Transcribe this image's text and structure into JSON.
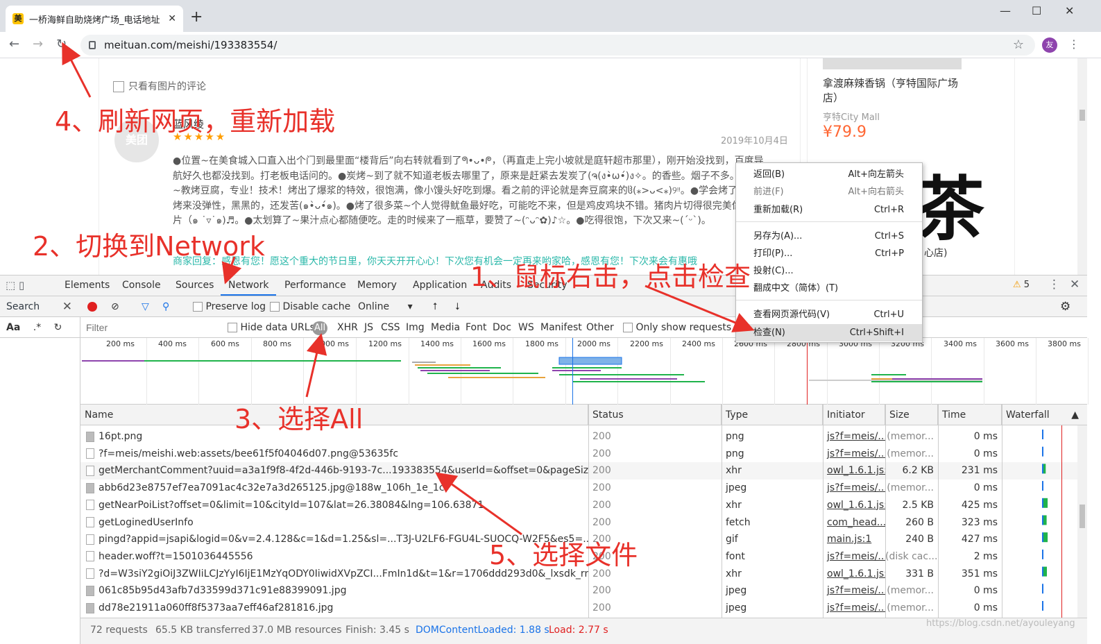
{
  "browser": {
    "tab_title": "一桥海鲜自助烧烤广场_电话地址",
    "tab_favicon": "美",
    "url": "meituan.com/meishi/193383554/",
    "avatar_letter": "友"
  },
  "page": {
    "only_pictures_label": "只看有图片的评论",
    "avatar_text": "美团",
    "reviewer_name": "蓝风绫",
    "stars": "★★★★★",
    "review_date": "2019年10月4日",
    "review_text": "●位置~在美食城入口直入出个门到最里面“楼背后”向右转就看到了ᖗ•ᴗ•ᖘ，（再直走上完小坡就是庭轩超市那里），刚开始没找到，百度导航好久也都没找到。打老板电话问的。●炭烤~到了就不知道老板去哪里了，原来是赶紧去发炭了(ຈ(ง•̀ω•́)ง✧。的香些。烟子不多。●老板~教烤豆腐，专业！技术！烤出了爆浆的特效，很饱满，像小馒头好吃到爆。看之前的评论就是奔豆腐来的ჱ(⁎>ᴗ<⁎)୨ᵎᵎ。●学会烤了~但是烤来没弹性，黑黑的，还发苦(๑•̀ᴗ•́๑)。●烤了很多菜~个人觉得鱿鱼最好吃，可能吃不来，但是鸡皮鸡块不错。猪肉片切得很完美像牛羊肉片（๑ ˙▿˙๑)♬。●太划算了~果汁点心都随便吃。走的时候来了一瓶草，要赞了~(ᵔᴗᵔ✿)♪☆。●吃得很饱，下次又来~(ˊᵕˋ)。",
    "merchant_reply": "商家回复：感恩有您！愿这个重大的节日里，你天天开开心心！下次您有机会一定再来哟家哈，感恩有您！下次来会有惠哦",
    "side_shop_name": "拿渡麻辣香锅（亨特国际广场店）",
    "side_shop_addr": "亨特City Mall",
    "side_shop_price": "¥79.9",
    "side_big_char": "茶",
    "side_big_sub": "心店)"
  },
  "devtools": {
    "tabs": [
      "Elements",
      "Console",
      "Sources",
      "Network",
      "Performance",
      "Memory",
      "Application",
      "Audits",
      "Security"
    ],
    "warning_count": "5",
    "search_label": "Search",
    "search_opts": "Aa",
    "regex_glyph": ".*",
    "preserve_log": "Preserve log",
    "disable_cache": "Disable cache",
    "throttle": "Online",
    "filter_placeholder": "Filter",
    "hide_data_urls": "Hide data URLs",
    "type_filters": [
      "All",
      "XHR",
      "JS",
      "CSS",
      "Img",
      "Media",
      "Font",
      "Doc",
      "WS",
      "Manifest",
      "Other"
    ],
    "only_show": "Only show requests wi",
    "ticks": [
      "200 ms",
      "400 ms",
      "600 ms",
      "800 ms",
      "1000 ms",
      "1200 ms",
      "1400 ms",
      "1600 ms",
      "1800 ms",
      "2000 ms",
      "2200 ms",
      "2400 ms",
      "2600 ms",
      "2800 ms",
      "3000 ms",
      "3200 ms",
      "3400 ms",
      "3600 ms",
      "3800 ms"
    ],
    "columns": [
      "Name",
      "Status",
      "Type",
      "Initiator",
      "Size",
      "Time",
      "Waterfall"
    ],
    "rows": [
      {
        "name": "16pt.png",
        "status": "200",
        "type": "png",
        "initiator": "js?f=meis/...",
        "size": "(memor...",
        "time": "0 ms",
        "icon": "img"
      },
      {
        "name": "?f=meis/meishi.web:assets/bee61f5f04046d07.png@53635fc",
        "status": "200",
        "type": "png",
        "initiator": "js?f=meis/...",
        "size": "(memor...",
        "time": "0 ms",
        "icon": "file"
      },
      {
        "name": "getMerchantComment?uuid=a3a1f9f8-4f2d-446b-9193-7c...193383554&userId=&offset=0&pageSize=10&sor...",
        "status": "200",
        "type": "xhr",
        "initiator": "owl_1.6.1.js:1",
        "size": "6.2 KB",
        "time": "231 ms",
        "icon": "file"
      },
      {
        "name": "abb6d23e8757ef7ea7091ac4c32e7a3d265125.jpg@188w_106h_1e_1c",
        "status": "200",
        "type": "jpeg",
        "initiator": "js?f=meis/...",
        "size": "(memor...",
        "time": "0 ms",
        "icon": "img"
      },
      {
        "name": "getNearPoiList?offset=0&limit=10&cityId=107&lat=26.38084&lng=106.63871",
        "status": "200",
        "type": "xhr",
        "initiator": "owl_1.6.1.js:1",
        "size": "2.5 KB",
        "time": "425 ms",
        "icon": "file"
      },
      {
        "name": "getLoginedUserInfo",
        "status": "200",
        "type": "fetch",
        "initiator": "com_head...",
        "size": "260 B",
        "time": "323 ms",
        "icon": "file"
      },
      {
        "name": "pingd?appid=jsapi&logid=0&v=2.4.128&c=1&d=1.25&sl=...T3J-U2LF6-FGU4L-SUOCQ-W2F5&es5=...",
        "status": "200",
        "type": "gif",
        "initiator": "main.js:1",
        "size": "240 B",
        "time": "427 ms",
        "icon": "file"
      },
      {
        "name": "header.woff?t=1501036445556",
        "status": "200",
        "type": "font",
        "initiator": "js?f=meis/...",
        "size": "(disk cac...",
        "time": "2 ms",
        "icon": "file"
      },
      {
        "name": "?d=W3siY2giOiJ3ZWIiLCJzYyI6IjE1MzYqODY0IiwidXVpZCI...FmIn1d&t=1&r=1706ddd293d0&_lxsdk_rnd=1706d...",
        "status": "200",
        "type": "xhr",
        "initiator": "owl_1.6.1.js:1",
        "size": "331 B",
        "time": "351 ms",
        "icon": "file"
      },
      {
        "name": "061c85b95d43afb7d33599d371c91e88399091.jpg",
        "status": "200",
        "type": "jpeg",
        "initiator": "js?f=meis/...",
        "size": "(memor...",
        "time": "0 ms",
        "icon": "img"
      },
      {
        "name": "dd78e21911a060ff8f5373aa7eff46af281816.jpg",
        "status": "200",
        "type": "jpeg",
        "initiator": "js?f=meis/...",
        "size": "(memor...",
        "time": "0 ms",
        "icon": "img"
      }
    ],
    "status": {
      "requests": "72 requests",
      "transferred": "65.5 KB transferred",
      "resources": "37.0 MB resources",
      "finish": "Finish: 3.45 s",
      "dcl": "DOMContentLoaded: 1.88 s",
      "load": "Load: 2.77 s"
    }
  },
  "context_menu": [
    {
      "label": "返回(B)",
      "shortcut": "Alt+向左箭头",
      "disabled": false
    },
    {
      "label": "前进(F)",
      "shortcut": "Alt+向右箭头",
      "disabled": true
    },
    {
      "label": "重新加载(R)",
      "shortcut": "Ctrl+R",
      "disabled": false
    },
    {
      "label": "另存为(A)...",
      "shortcut": "Ctrl+S",
      "disabled": false
    },
    {
      "label": "打印(P)...",
      "shortcut": "Ctrl+P",
      "disabled": false
    },
    {
      "label": "投射(C)...",
      "shortcut": "",
      "disabled": false
    },
    {
      "label": "翻成中文（简体）(T)",
      "shortcut": "",
      "disabled": false
    },
    {
      "label": "查看网页源代码(V)",
      "shortcut": "Ctrl+U",
      "disabled": false
    },
    {
      "label": "检查(N)",
      "shortcut": "Ctrl+Shift+I",
      "disabled": false
    }
  ],
  "annotations": {
    "step1": "1、鼠标右击，点击检查",
    "step2": "2、切换到Network",
    "step3": "3、选择All",
    "step4": "4、刷新网页，重新加载",
    "step5": "5、选择文件"
  },
  "watermark": "https://blog.csdn.net/ayouleyang",
  "colors": {
    "annotation_red": "#e8312a",
    "accent_blue": "#1a73e8",
    "reply_teal": "#2bb8aa",
    "price_orange": "#ff6633"
  }
}
